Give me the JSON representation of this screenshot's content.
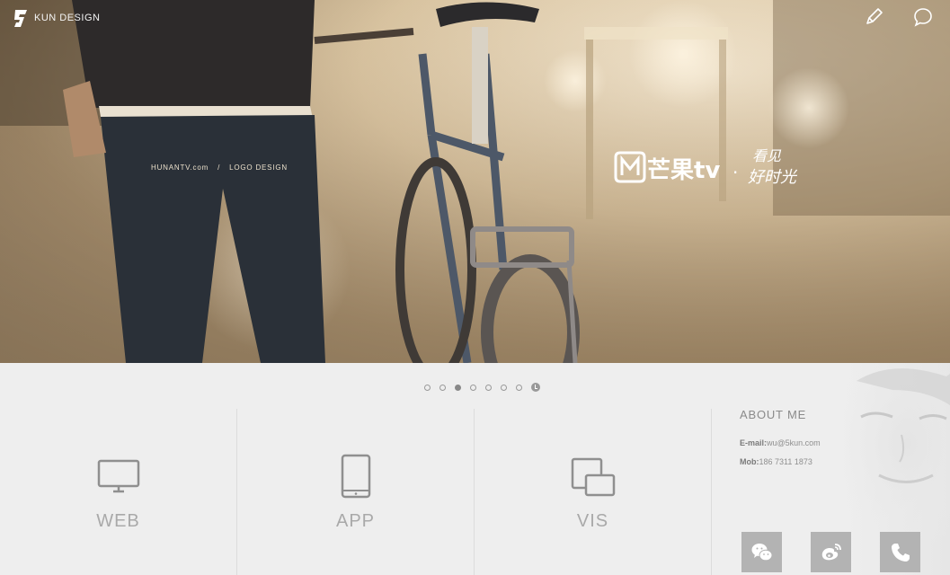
{
  "brand": {
    "name": "KUN DESIGN"
  },
  "header_icons": [
    "pencil-icon",
    "chat-bubble-icon"
  ],
  "hero": {
    "caption_left": "HUNANTV.com",
    "caption_sep": "/",
    "caption_right": "LOGO DESIGN",
    "logo_text": "芒果tv",
    "logo_dot": "·",
    "logo_slogan_line1": "看见",
    "logo_slogan_line2": "好时光"
  },
  "slider": {
    "count": 7,
    "active_index": 2
  },
  "services": [
    {
      "label": "WEB",
      "icon": "monitor-icon"
    },
    {
      "label": "APP",
      "icon": "tablet-icon"
    },
    {
      "label": "VIS",
      "icon": "devices-icon"
    }
  ],
  "about": {
    "title": "ABOUT ME",
    "email_label": "E-mail:",
    "email_value": "wu@5kun.com",
    "mob_label": "Mob:",
    "mob_value": "186 7311 1873",
    "social": [
      "wechat-icon",
      "weibo-icon",
      "phone-icon"
    ]
  },
  "colors": {
    "hero_warm": "#d8c3a0",
    "panel_bg": "#eeeeee",
    "social_bg": "#b3b3b3",
    "label_gray": "#a9a9a9"
  }
}
